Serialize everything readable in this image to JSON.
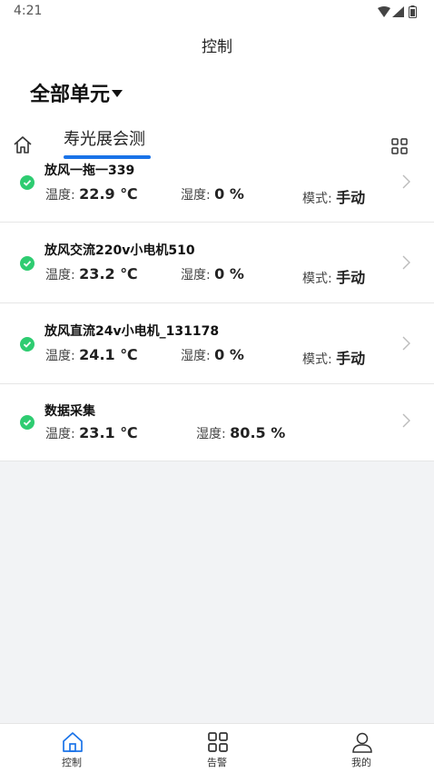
{
  "status_bar": {
    "time": "4:21"
  },
  "header": {
    "title": "控制",
    "unit_selector": "全部单元",
    "active_tab": "寿光展会测"
  },
  "devices": [
    {
      "name": "放风一拖一339",
      "temp_label": "温度:",
      "temp_value": "22.9 ℃",
      "hum_label": "湿度:",
      "hum_value": "0 %",
      "mode_label": "模式:",
      "mode_value": "手动",
      "status": "online"
    },
    {
      "name": "放风交流220v小电机510",
      "temp_label": "温度:",
      "temp_value": "23.2 ℃",
      "hum_label": "湿度:",
      "hum_value": "0 %",
      "mode_label": "模式:",
      "mode_value": "手动",
      "status": "online"
    },
    {
      "name": "放风直流24v小电机_131178",
      "temp_label": "温度:",
      "temp_value": "24.1 ℃",
      "hum_label": "湿度:",
      "hum_value": "0 %",
      "mode_label": "模式:",
      "mode_value": "手动",
      "status": "online"
    },
    {
      "name": "数据采集",
      "temp_label": "温度:",
      "temp_value": "23.1 ℃",
      "hum_label": "湿度:",
      "hum_value": "80.5 %",
      "status": "online"
    }
  ],
  "bottom_nav": [
    {
      "label": "控制",
      "icon": "home-icon",
      "active": true
    },
    {
      "label": "告警",
      "icon": "grid-icon",
      "active": false
    },
    {
      "label": "我的",
      "icon": "person-icon",
      "active": false
    }
  ],
  "colors": {
    "accent": "#1a73e8",
    "online": "#2ecc71"
  }
}
